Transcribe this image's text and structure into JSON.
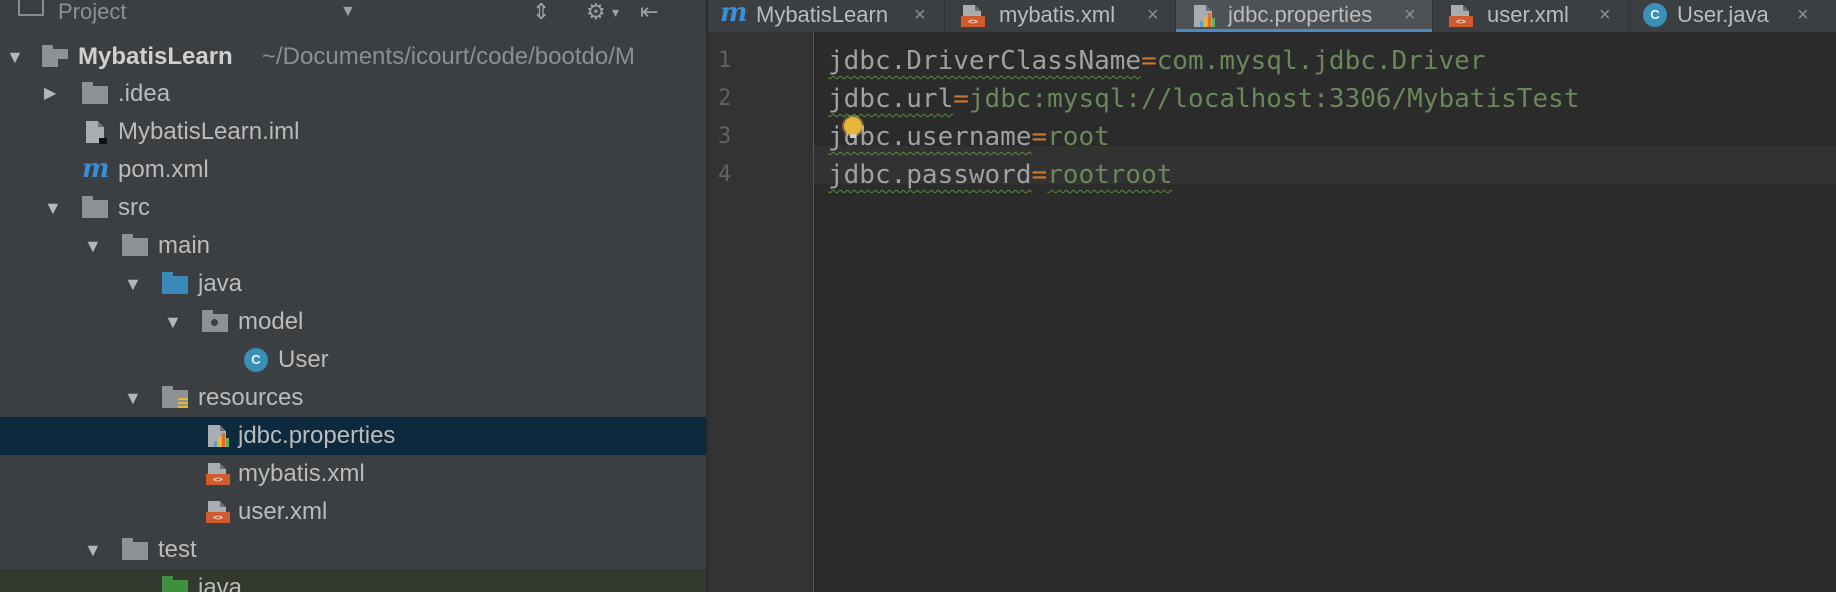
{
  "project_panel": {
    "title": "Project",
    "icons": [
      "project-icon",
      "dropdown-chevron-icon",
      "collapse-all-icon",
      "gear-icon",
      "hide-panel-icon"
    ],
    "tree": [
      {
        "label": "MybatisLearn",
        "path": "~/Documents/icourt/code/bootdo/M",
        "type": "module",
        "expanded": true
      },
      {
        "label": ".idea",
        "type": "folder",
        "expanded": false
      },
      {
        "label": "MybatisLearn.iml",
        "type": "iml-file"
      },
      {
        "label": "pom.xml",
        "type": "maven-file"
      },
      {
        "label": "src",
        "type": "folder",
        "expanded": true
      },
      {
        "label": "main",
        "type": "folder",
        "expanded": true
      },
      {
        "label": "java",
        "type": "source-folder",
        "expanded": true
      },
      {
        "label": "model",
        "type": "package",
        "expanded": true
      },
      {
        "label": "User",
        "type": "class"
      },
      {
        "label": "resources",
        "type": "resources-folder",
        "expanded": true
      },
      {
        "label": "jdbc.properties",
        "type": "properties-file",
        "selected": true
      },
      {
        "label": "mybatis.xml",
        "type": "xml-file"
      },
      {
        "label": "user.xml",
        "type": "xml-file"
      },
      {
        "label": "test",
        "type": "folder",
        "expanded": true
      },
      {
        "label": "java",
        "type": "test-source-folder"
      }
    ]
  },
  "editor": {
    "tabs": [
      {
        "label": "MybatisLearn",
        "icon": "maven-icon"
      },
      {
        "label": "mybatis.xml",
        "icon": "xml-file-icon"
      },
      {
        "label": "jdbc.properties",
        "icon": "properties-file-icon",
        "active": true
      },
      {
        "label": "user.xml",
        "icon": "xml-file-icon"
      },
      {
        "label": "User.java",
        "icon": "class-icon"
      }
    ],
    "close_glyph": "×",
    "lines": [
      {
        "num": "1",
        "key": "jdbc.DriverClassName",
        "eq": "=",
        "value": "com.mysql.jdbc.Driver"
      },
      {
        "num": "2",
        "key": "jdbc.url",
        "eq": "=",
        "value": "jdbc:mysql://localhost:3306/MybatisTest"
      },
      {
        "num": "3",
        "key": "jdbc.username",
        "eq": "=",
        "value": "root"
      },
      {
        "num": "4",
        "key": "jdbc.password",
        "eq": "=",
        "value": "rootroot"
      }
    ]
  },
  "colors": {
    "panel_bg": "#3c3f41",
    "editor_bg": "#2b2b2b",
    "selection": "#0d293e",
    "property_key": "#9ea1a4",
    "property_value": "#6a8759",
    "accent": "#4a88c7"
  }
}
